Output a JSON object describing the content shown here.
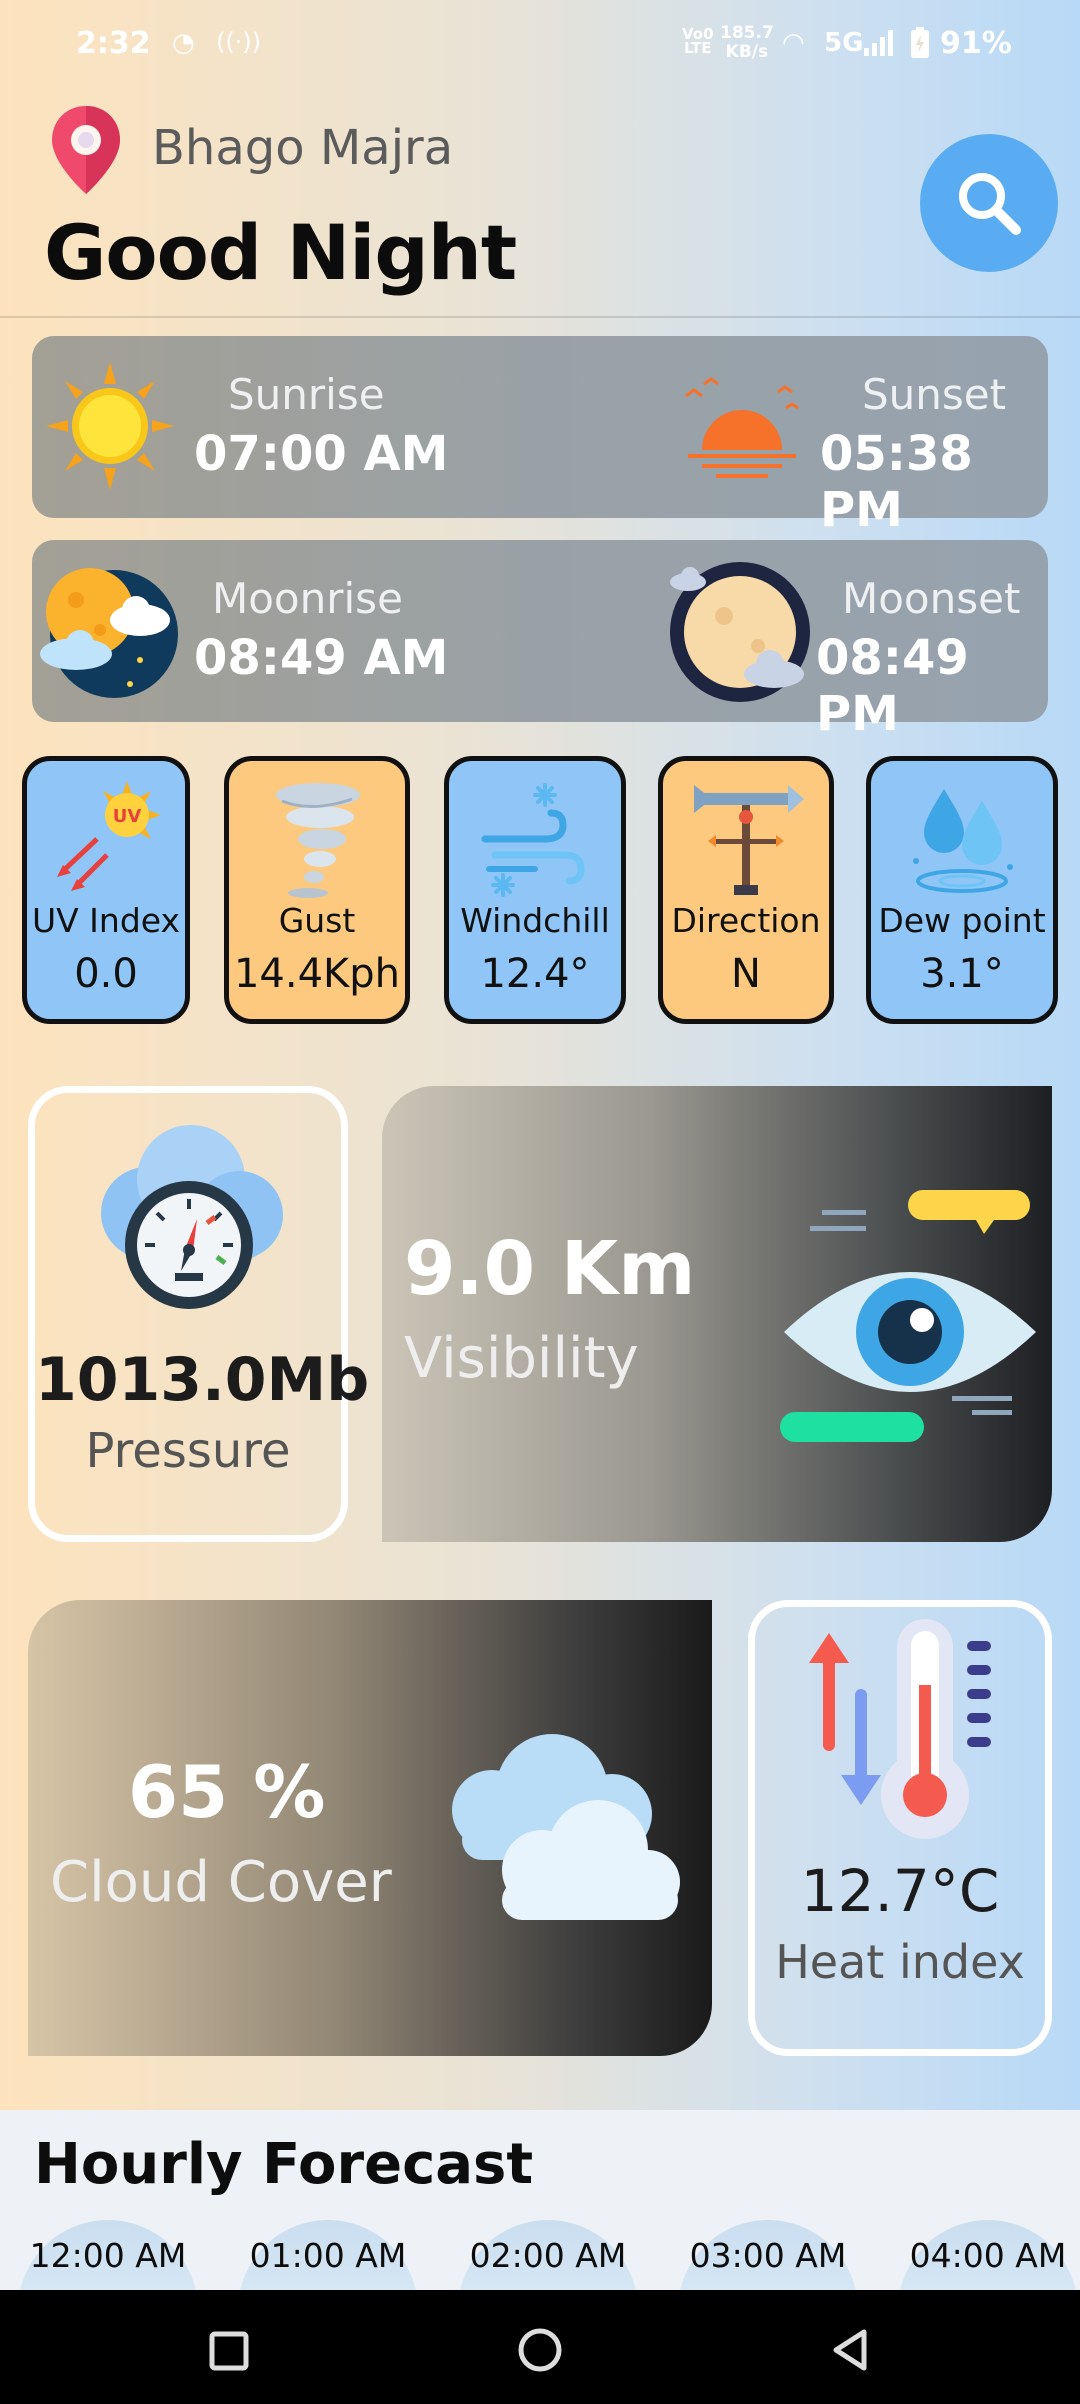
{
  "status_bar": {
    "time": "2:32",
    "network_type_top": "Vo0",
    "network_type_bottom": "LTE",
    "speed_value": "185.7",
    "speed_unit": "KB/s",
    "signal": "5G",
    "battery": "91%"
  },
  "header": {
    "location": "Bhago Majra",
    "greeting": "Good Night"
  },
  "sun": {
    "sunrise_label": "Sunrise",
    "sunrise_time": "07:00 AM",
    "sunset_label": "Sunset",
    "sunset_time": "05:38 PM"
  },
  "moon": {
    "moonrise_label": "Moonrise",
    "moonrise_time": "08:49 AM",
    "moonset_label": "Moonset",
    "moonset_time": "08:49 PM"
  },
  "metrics": [
    {
      "label": "UV Index",
      "value": "0.0",
      "color": "#8fc6f7",
      "icon": "uv-sun-icon"
    },
    {
      "label": "Gust",
      "value": "14.4Kph",
      "color": "#fcc97f",
      "icon": "tornado-icon"
    },
    {
      "label": "Windchill",
      "value": "12.4°",
      "color": "#8fc6f7",
      "icon": "wind-snow-icon"
    },
    {
      "label": "Direction",
      "value": "N",
      "color": "#fcc97f",
      "icon": "weathervane-icon"
    },
    {
      "label": "Dew point",
      "value": "3.1°",
      "color": "#8fc6f7",
      "icon": "water-drops-icon"
    }
  ],
  "pressure": {
    "value": "1013.0Mb",
    "label": "Pressure"
  },
  "visibility": {
    "value": "9.0 Km",
    "label": "Visibility"
  },
  "cloud_cover": {
    "value": "65 %",
    "label": "Cloud Cover"
  },
  "heat_index": {
    "value": "12.7°C",
    "label": "Heat index"
  },
  "hourly": {
    "title": "Hourly Forecast",
    "hours": [
      "12:00 AM",
      "01:00 AM",
      "02:00 AM",
      "03:00 AM",
      "04:00 AM"
    ]
  },
  "colors": {
    "accent": "#5aacf2",
    "card_blue": "#8fc6f7",
    "card_orange": "#fcc97f"
  }
}
